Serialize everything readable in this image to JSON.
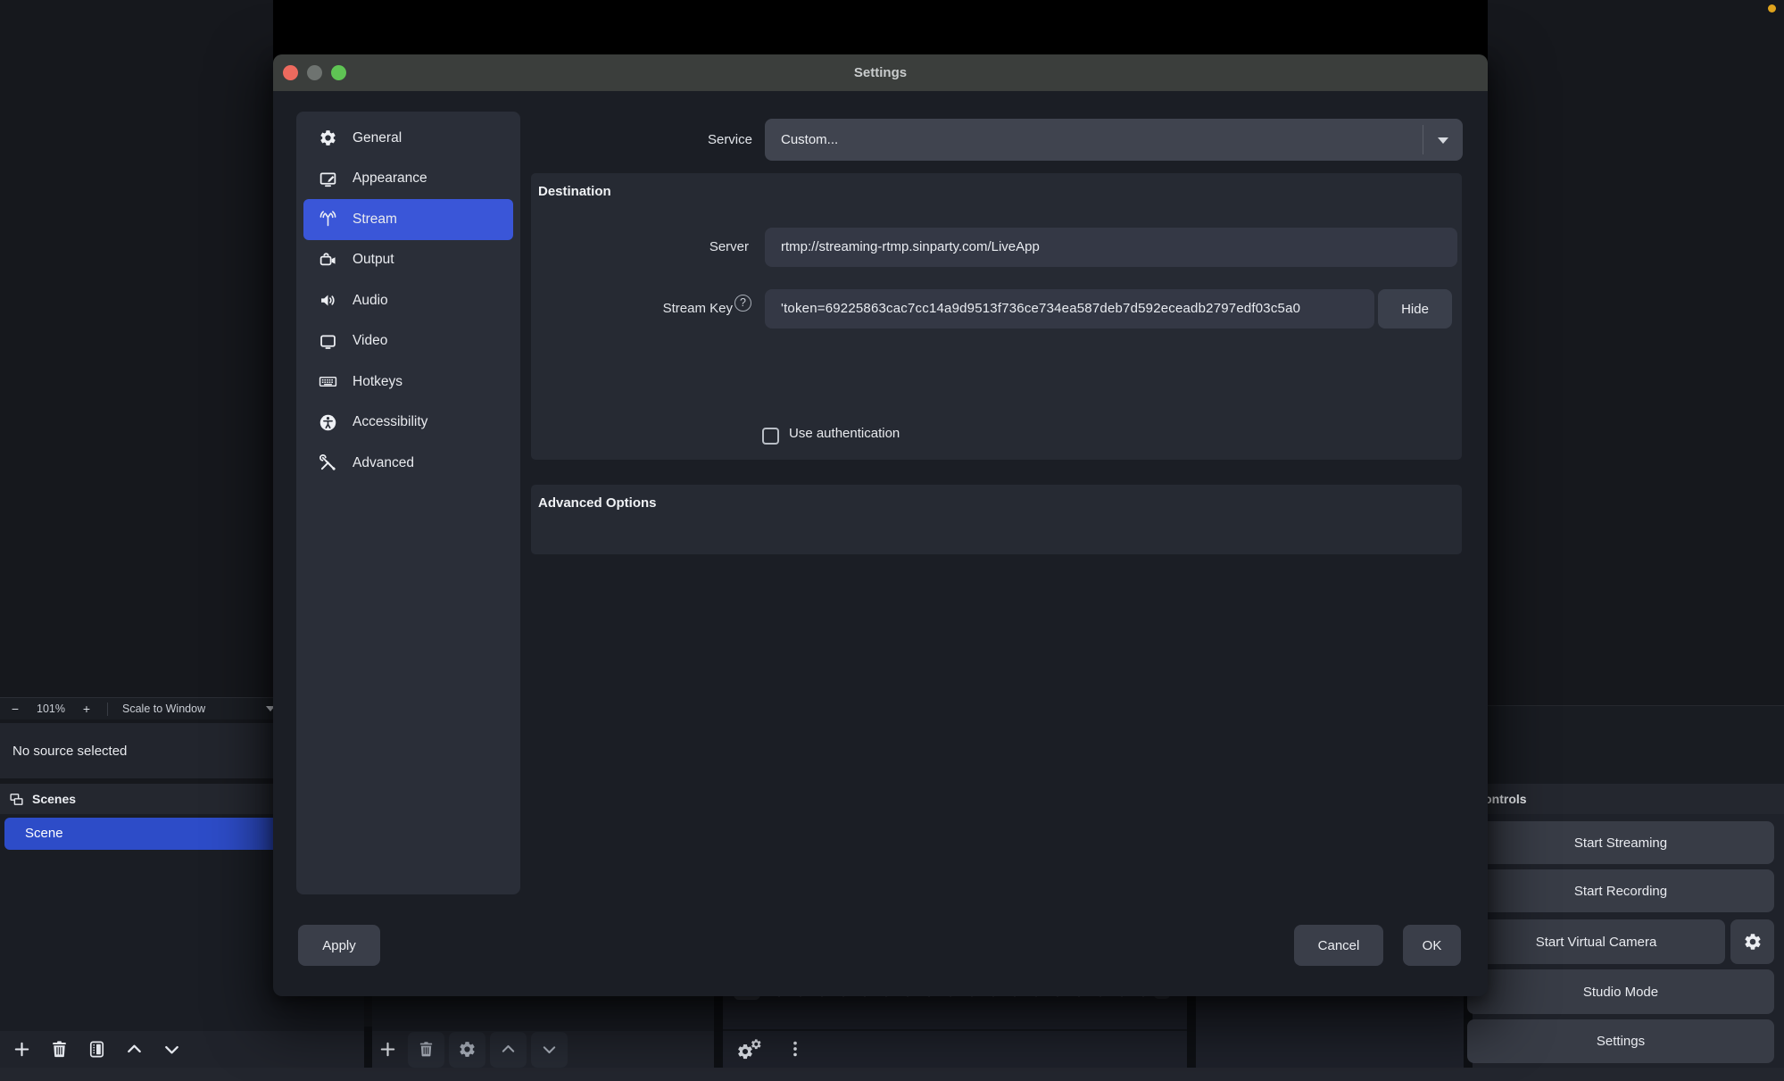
{
  "preview": {
    "zoom_out_label": "−",
    "zoom_level": "101%",
    "zoom_in_label": "+",
    "scale_mode": "Scale to Window",
    "no_source_text": "No source selected"
  },
  "scenes": {
    "heading": "Scenes",
    "items": [
      {
        "label": "Scene",
        "selected": true
      }
    ]
  },
  "controls": {
    "heading": "Controls",
    "buttons": [
      {
        "label": "Start Streaming"
      },
      {
        "label": "Start Recording"
      },
      {
        "label": "Start Virtual Camera"
      },
      {
        "label": "Studio Mode"
      },
      {
        "label": "Settings"
      }
    ]
  },
  "dialog": {
    "title": "Settings",
    "sidebar": {
      "items": [
        {
          "label": "General",
          "icon": "gear-icon"
        },
        {
          "label": "Appearance",
          "icon": "appearance-icon"
        },
        {
          "label": "Stream",
          "icon": "broadcast-icon",
          "selected": true
        },
        {
          "label": "Output",
          "icon": "camcorder-icon"
        },
        {
          "label": "Audio",
          "icon": "speaker-icon"
        },
        {
          "label": "Video",
          "icon": "display-icon"
        },
        {
          "label": "Hotkeys",
          "icon": "keyboard-icon"
        },
        {
          "label": "Accessibility",
          "icon": "accessibility-icon"
        },
        {
          "label": "Advanced",
          "icon": "tools-icon"
        }
      ]
    },
    "service": {
      "label": "Service",
      "value": "Custom..."
    },
    "destination": {
      "heading": "Destination",
      "server": {
        "label": "Server",
        "value": "rtmp://streaming-rtmp.sinparty.com/LiveApp"
      },
      "stream_key": {
        "label": "Stream Key",
        "help_glyph": "?",
        "value": "'token=69225863cac7cc14a9d9513f736ce734ea587deb7d592eceadb2797edf03c5a0",
        "hide_button_label": "Hide"
      },
      "use_authentication": {
        "label": "Use authentication",
        "checked": false
      }
    },
    "advanced_options": {
      "heading": "Advanced Options"
    },
    "footer": {
      "apply_label": "Apply",
      "cancel_label": "Cancel",
      "ok_label": "OK"
    }
  },
  "colors": {
    "accent_blue": "#3a56d8",
    "scene_selection_blue": "#2d4cc8",
    "dialog_bg": "#1b1e25",
    "section_panel_bg": "#262a33",
    "field_bg": "#343845",
    "button_bg": "#3a3e49",
    "titlebar_bg": "#3b3e3c",
    "traffic_red": "#ed6a5e",
    "traffic_gray": "#6e7370",
    "traffic_green": "#5fc454",
    "status_dot": "#dfa31d"
  }
}
